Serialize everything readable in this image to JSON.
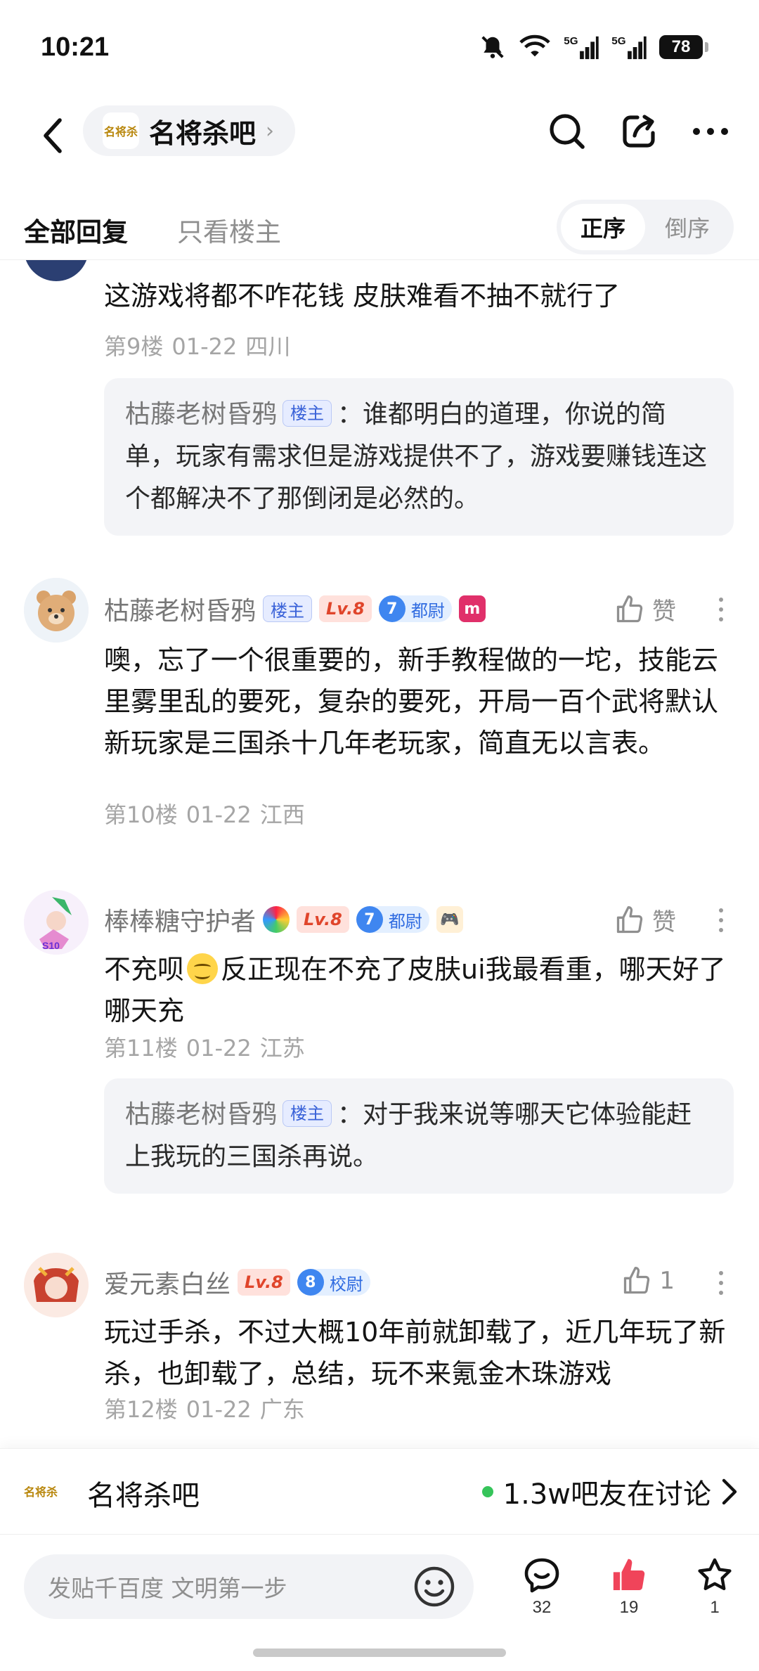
{
  "status": {
    "time": "10:21",
    "battery": "78",
    "net1": "5G",
    "net2": "5G"
  },
  "header": {
    "forum_name": "名将杀吧",
    "forum_logo": "名将杀"
  },
  "tabs": {
    "all": "全部回复",
    "owner_only": "只看楼主",
    "order_asc": "正序",
    "order_desc": "倒序"
  },
  "posts": [
    {
      "body": "这游戏将都不咋花钱 皮肤难看不抽不就行了",
      "floor": "第9楼",
      "date": "01-22",
      "location": "四川",
      "reply": {
        "name": "枯藤老树昏鸦",
        "badge": "楼主",
        "text": "：谁都明白的道理，你说的简单，玩家有需求但是游戏提供不了，游戏要赚钱连这个都解决不了那倒闭是必然的。"
      }
    },
    {
      "username": "枯藤老树昏鸦",
      "host_badge": "楼主",
      "level": "Lv.8",
      "rank_num": "7",
      "rank_title": "都尉",
      "like_label": "赞",
      "body": "噢，忘了一个很重要的，新手教程做的一坨，技能云里雾里乱的要死，复杂的要死，开局一百个武将默认新玩家是三国杀十几年老玩家，简直无以言表。",
      "floor": "第10楼",
      "date": "01-22",
      "location": "江西"
    },
    {
      "username": "棒棒糖守护者",
      "level": "Lv.8",
      "rank_num": "7",
      "rank_title": "都尉",
      "like_label": "赞",
      "body_pre": "不充呗",
      "body_post": "反正现在不充了皮肤ui我最看重，哪天好了哪天充",
      "floor": "第11楼",
      "date": "01-22",
      "location": "江苏",
      "reply": {
        "name": "枯藤老树昏鸦",
        "badge": "楼主",
        "text": "：对于我来说等哪天它体验能赶上我玩的三国杀再说。"
      }
    },
    {
      "username": "爱元素白丝",
      "level": "Lv.8",
      "rank_num": "8",
      "rank_title": "校尉",
      "like_count": "1",
      "body": "玩过手杀，不过大概10年前就卸载了，近几年玩了新杀，也卸载了，总结，玩不来氪金木珠游戏",
      "floor": "第12楼",
      "date": "01-22",
      "location": "广东"
    }
  ],
  "forum_bar": {
    "name": "名将杀吧",
    "online": "1.3w吧友在讨论"
  },
  "input": {
    "placeholder": "发贴千百度 文明第一步"
  },
  "actions": {
    "comments": "32",
    "likes": "19",
    "favorites": "1"
  },
  "colors": {
    "accent": "#3a62d8",
    "like_red": "#f0445a",
    "level_red": "#e0452b",
    "online_green": "#36c45a"
  }
}
